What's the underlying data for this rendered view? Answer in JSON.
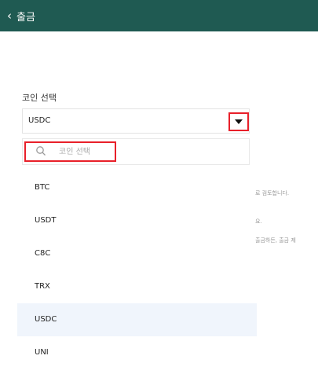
{
  "header": {
    "back_glyph": "‹",
    "title": "출금"
  },
  "coin_select": {
    "label": "코인 선택",
    "selected_value": "USDC"
  },
  "search": {
    "placeholder": "코인 선택",
    "value": ""
  },
  "background_text": {
    "line1": "로 검토합니다.",
    "line2": "요.",
    "line3": "출금하든, 출금 제"
  },
  "coin_list": {
    "items": [
      "BTC",
      "USDT",
      "C8C",
      "TRX",
      "USDC",
      "UNI"
    ],
    "selected": "USDC"
  },
  "colors": {
    "header_bg": "#1f5a52",
    "highlight_border": "#e8202a",
    "selected_row_bg": "#f0f5fc"
  }
}
